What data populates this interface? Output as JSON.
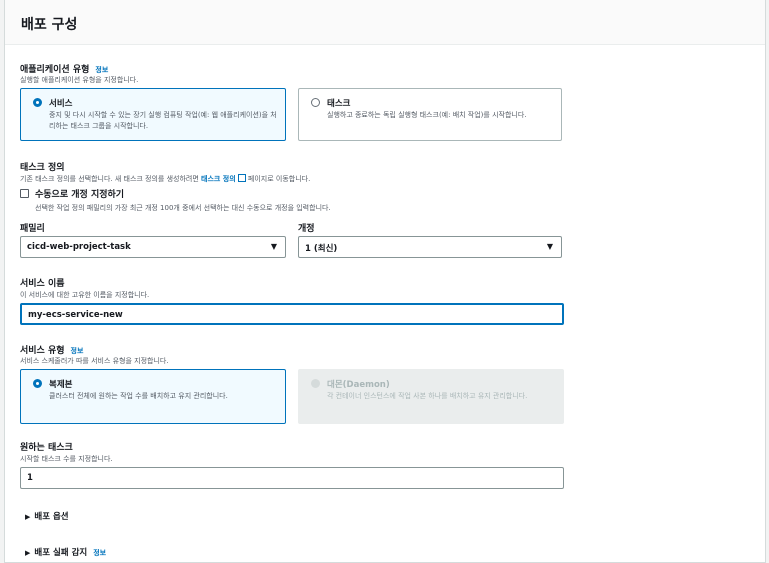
{
  "header": {
    "title": "배포 구성"
  },
  "app_type": {
    "label": "애플리케이션 유형",
    "info": "정보",
    "description": "실행할 애플리케이션 유형을 지정합니다.",
    "options": [
      {
        "title": "서비스",
        "description": "중지 및 다시 시작할 수 있는 장기 실행 컴퓨팅 작업(예: 웹 애플리케이션)을 처리하는 태스크 그룹을 시작합니다.",
        "selected": true
      },
      {
        "title": "태스크",
        "description": "실행하고 종료하는 독립 실행형 태스크(예: 배치 작업)를 시작합니다.",
        "selected": false
      }
    ]
  },
  "task_definition": {
    "label": "태스크 정의",
    "description_prefix": "기존 태스크 정의를 선택합니다. 새 태스크 정의를 생성하려면 ",
    "description_link": "태스크 정의",
    "description_suffix": " 페이지로 이동합니다.",
    "manual_checkbox_label": "수동으로 개정 지정하기",
    "manual_checkbox_checked": false,
    "manual_checkbox_description": "선택한 작업 정의 패밀리의 가장 최근 개정 100개 중에서 선택하는 대신 수동으로 개정을 입력합니다.",
    "family_label": "패밀리",
    "family_value": "cicd-web-project-task",
    "revision_label": "개정",
    "revision_value": "1 (최신)"
  },
  "service_name": {
    "label": "서비스 이름",
    "description": "이 서비스에 대한 고유한 이름을 지정합니다.",
    "value": "my-ecs-service-new"
  },
  "service_type": {
    "label": "서비스 유형",
    "info": "정보",
    "description": "서비스 스케줄러가 따를 서비스 유형을 지정합니다.",
    "options": [
      {
        "title": "복제본",
        "description": "클러스터 전체에 원하는 작업 수를 배치하고 유지 관리합니다.",
        "selected": true,
        "disabled": false
      },
      {
        "title": "대몬(Daemon)",
        "description": "각 컨테이너 인스턴스에 작업 사본 하나를 배치하고 유지 관리합니다.",
        "selected": false,
        "disabled": true
      }
    ]
  },
  "desired_tasks": {
    "label": "원하는 태스크",
    "description": "시작할 태스크 수를 지정합니다.",
    "value": "1"
  },
  "expanders": {
    "deploy_options": "배포 옵션",
    "failure_detection": "배포 실패 감지",
    "failure_detection_info": "정보",
    "arrow": "▶"
  },
  "icons": {
    "caret": "▼"
  }
}
